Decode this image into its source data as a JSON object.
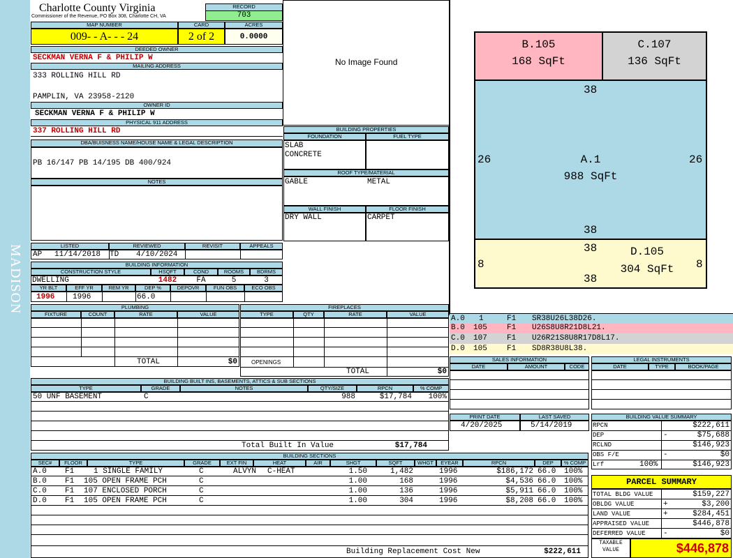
{
  "county": {
    "title": "Charlotte County Virginia",
    "subtitle": "Commissioner of the Revenue, PO Box 308, Charlotte CH, VA"
  },
  "side_label": "MADISON",
  "record": {
    "label": "RECORD",
    "value": "703"
  },
  "map": {
    "label": "MAP NUMBER",
    "value": "009- - A- - - 24"
  },
  "card": {
    "label": "CARD",
    "value": "2 of 2"
  },
  "acres": {
    "label": "ACRES",
    "value": "0.0000"
  },
  "owner": {
    "label": "DEEDED OWNER",
    "value": "SECKMAN VERNA F & PHILIP W"
  },
  "mailing": {
    "label": "MAILING ADDRESS",
    "line1": "333 ROLLING HILL RD",
    "line2": "PAMPLIN, VA 23958-2120"
  },
  "owner_id": {
    "label": "OWNER ID",
    "value": "SECKMAN VERNA F & PHILIP W"
  },
  "physical": {
    "label": "PHYSICAL 911 ADDRESS",
    "value": "337 ROLLING HILL RD"
  },
  "legal": {
    "label": "DBA/BUISNESS NAME/HOUSE NAME & LEGAL DESCRIPTION",
    "value": "PB 16/147 PB 14/195 DB 400/924"
  },
  "notes": {
    "label": "NOTES"
  },
  "photo": {
    "text": "No Image Found"
  },
  "building_properties": {
    "label": "BUILDING PROPERTIES",
    "foundation_label": "FOUNDATION",
    "fuel_label": "FUEL TYPE",
    "foundation1": "SLAB",
    "foundation2": "CONCRETE",
    "roof_label": "ROOF TYPE/MATERIAL",
    "roof_type": "GABLE",
    "roof_material": "METAL",
    "wall_label": "WALL FINISH",
    "floor_label": "FLOOR FINISH",
    "wall": "DRY WALL",
    "floor": "CARPET"
  },
  "listing": {
    "listed_label": "LISTED",
    "reviewed_label": "REVIEWED",
    "revisit_label": "REVISIT",
    "appeals_label": "APPEALS",
    "listed_code": "AP",
    "listed": "11/14/2018",
    "reviewed_code": "TD",
    "reviewed": "4/10/2024"
  },
  "building_info": {
    "label": "BUILDING INFORMATION",
    "style_label": "CONSTRUCTION STYLE",
    "hsqft_label": "HSQFT",
    "cond_label": "COND",
    "rooms_label": "ROOMS",
    "bdrms_label": "BDRMS",
    "style": "DWELLING",
    "hsqft": "1482",
    "cond": "FA",
    "rooms": "5",
    "bdrms": "3",
    "yrblt_label": "YR BLT",
    "effyr_label": "EFF YR",
    "remyr_label": "REM YR",
    "dep_label": "DEP %",
    "depovr_label": "DEPOVR",
    "funobs_label": "FUN OBS",
    "ecoobs_label": "ECO OBS",
    "yrblt": "1996",
    "effyr": "1996",
    "dep": "66.0"
  },
  "plumbing": {
    "label": "PLUMBING",
    "fixture_label": "FIXTURE",
    "count_label": "COUNT",
    "rate_label": "RATE",
    "value_label": "VALUE",
    "total_label": "TOTAL",
    "total": "$0"
  },
  "fireplaces": {
    "label": "FIREPLACES",
    "type_label": "TYPE",
    "qty_label": "QTY",
    "rate_label": "RATE",
    "value_label": "VALUE",
    "openings_label": "OPENINGS",
    "total_label": "TOTAL",
    "total": "$0"
  },
  "builtins": {
    "label": "BUILDING BUILT INS, BASEMENTS, ATTICS & SUB SECTIONS",
    "type_label": "TYPE",
    "grade_label": "GRADE",
    "notes_label": "NOTES",
    "qty_label": "QTY/SIZE",
    "rpcn_label": "RPCN",
    "comp_label": "% COMP",
    "rows": [
      {
        "type": "50 UNF BASEMENT",
        "grade": "C",
        "notes": "",
        "qty": "988",
        "rpcn": "$17,784",
        "comp": "100%"
      }
    ],
    "total_label": "Total Built In Value",
    "total": "$17,784"
  },
  "sketch": {
    "areas": [
      {
        "code": "B.105",
        "sqft": "168 SqFt",
        "color": "#ffb6c1"
      },
      {
        "code": "C.107",
        "sqft": "136 SqFt",
        "color": "#d3d3d3"
      },
      {
        "code": "A.1",
        "sqft": "988 SqFt",
        "color": "#add8e6"
      },
      {
        "code": "D.105",
        "sqft": "304 SqFt",
        "color": "#fffacd"
      }
    ],
    "dims": {
      "a_top": "38",
      "a_left": "26",
      "a_right": "26",
      "a_bottom": "38",
      "d_top": "38",
      "d_left": "8",
      "d_right": "8",
      "d_bottom": "38"
    }
  },
  "sketch_codes": [
    {
      "c1": "A.0",
      "c2": "1",
      "c3": "F1",
      "c4": "SR38U26L38D26.",
      "color": "#add8e6"
    },
    {
      "c1": "B.0",
      "c2": "105",
      "c3": "F1",
      "c4": "U26S8U8R21D8L21.",
      "color": "#ffb6c1"
    },
    {
      "c1": "C.0",
      "c2": "107",
      "c3": "F1",
      "c4": "U26R21S8U8R17D8L17.",
      "color": "#d3d3d3"
    },
    {
      "c1": "D.0",
      "c2": "105",
      "c3": "F1",
      "c4": "SD8R38U8L38.",
      "color": "#fffacd"
    }
  ],
  "sales": {
    "label": "SALES INFORMATION",
    "date_label": "DATE",
    "amount_label": "AMOUNT",
    "code_label": "CODE"
  },
  "legal_instruments": {
    "label": "LEGAL INSTRUMENTS",
    "date_label": "DATE",
    "type_label": "TYPE",
    "book_label": "BOOK/PAGE"
  },
  "print": {
    "print_label": "PRINT DATE",
    "print": "4/20/2025",
    "saved_label": "LAST SAVED",
    "saved": "5/14/2019"
  },
  "value_summary": {
    "label": "BUILDING VALUE SUMMARY",
    "rows": [
      {
        "label": "RPCN",
        "sign": "",
        "value": "$222,611"
      },
      {
        "label": "DEP",
        "sign": "-",
        "value": "$75,688"
      },
      {
        "label": "RCLND",
        "sign": "",
        "value": "$146,923"
      },
      {
        "label": "OBS F/E",
        "sign": "-",
        "value": "$0"
      },
      {
        "label": "Lrf",
        "sign": "100%",
        "value": "$146,923"
      }
    ]
  },
  "parcel_summary": {
    "label": "PARCEL SUMMARY",
    "rows": [
      {
        "label": "TOTAL BLDG VALUE",
        "sign": "",
        "value": "$159,227"
      },
      {
        "label": "OBLDG VALUE",
        "sign": "+",
        "value": "$3,200"
      },
      {
        "label": "LAND VALUE",
        "sign": "+",
        "value": "$284,451"
      },
      {
        "label": "APPRAISED VALUE",
        "sign": "",
        "value": "$446,878"
      },
      {
        "label": "DEFERRED VALUE",
        "sign": "-",
        "value": "$0"
      }
    ],
    "taxable_label1": "TAXABLE",
    "taxable_label2": "VALUE",
    "taxable": "$446,878"
  },
  "sections": {
    "label": "BUILDING SECTIONS",
    "headers": [
      "SEC#",
      "FLOOR",
      "TYPE",
      "GRADE",
      "EXT FIN",
      "HEAT",
      "AIR",
      "SHGT",
      "SQFT",
      "WHGT",
      "EYEAR",
      "RPCN",
      "DEP",
      "% COMP"
    ],
    "rows": [
      [
        "A.0",
        "F1",
        "1 SINGLE FAMILY",
        "C",
        "ALVYN",
        "C-HEAT",
        "",
        "1.50",
        "1,482",
        "",
        "1996",
        "$186,172",
        "66.0",
        "100%"
      ],
      [
        "B.0",
        "F1",
        "105 OPEN FRAME PCH",
        "C",
        "",
        "",
        "",
        "1.00",
        "168",
        "",
        "1996",
        "$4,536",
        "66.0",
        "100%"
      ],
      [
        "C.0",
        "F1",
        "107 ENCLOSED PORCH",
        "C",
        "",
        "",
        "",
        "1.00",
        "136",
        "",
        "1996",
        "$5,911",
        "66.0",
        "100%"
      ],
      [
        "D.0",
        "F1",
        "105 OPEN FRAME PCH",
        "C",
        "",
        "",
        "",
        "1.00",
        "304",
        "",
        "1996",
        "$8,208",
        "66.0",
        "100%"
      ]
    ],
    "rcn_label": "Building Replacement Cost New",
    "rcn": "$222,611"
  }
}
